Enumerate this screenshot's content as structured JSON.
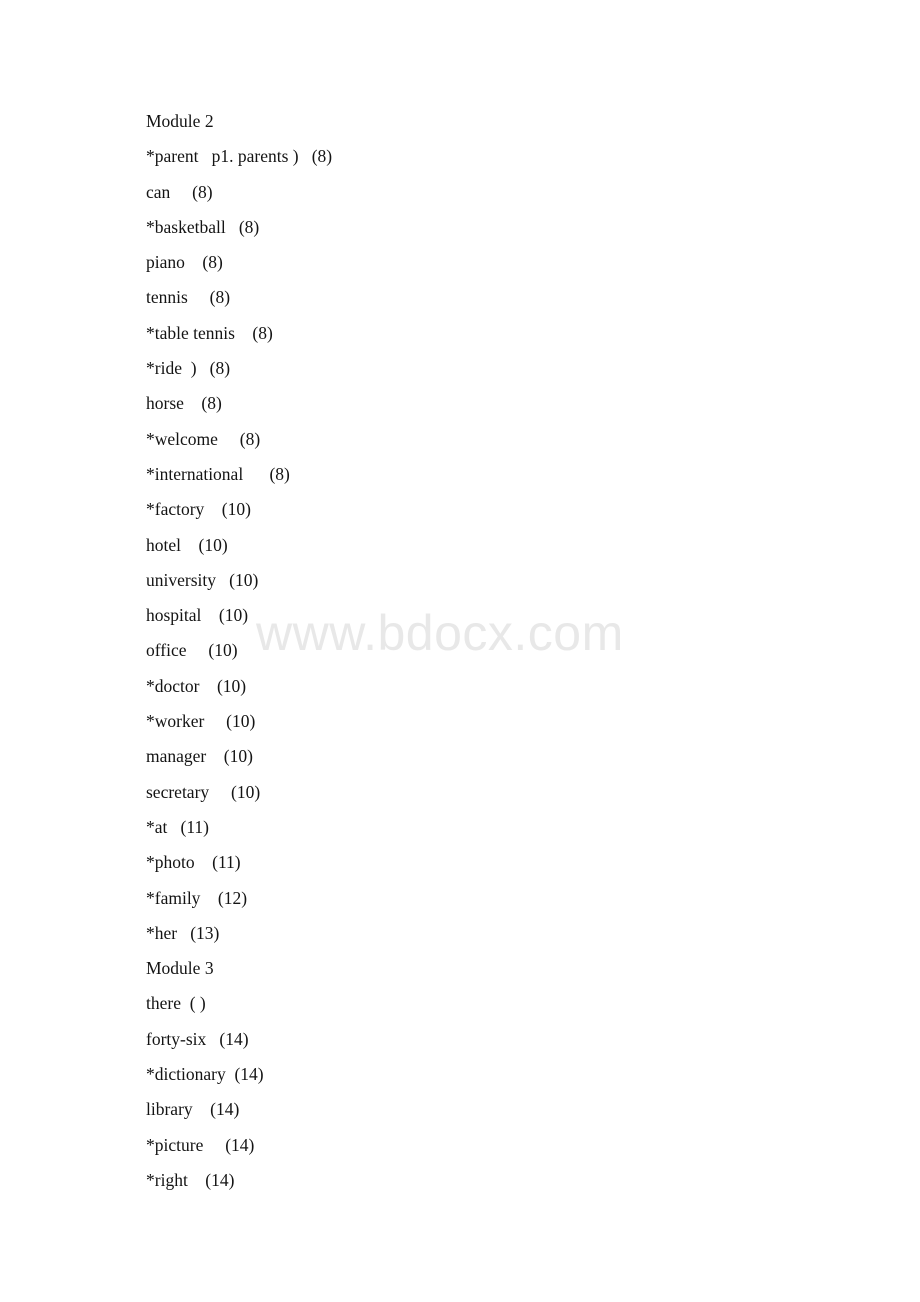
{
  "document": {
    "background_color": "#ffffff",
    "text_color": "#141414",
    "watermark": {
      "text": "www.bdocx.com",
      "color": "#e8e8e8"
    },
    "lines": [
      {
        "text": "Module 2"
      },
      {
        "text": "*parent   p1. parents )   (8)"
      },
      {
        "text": "can     (8)"
      },
      {
        "text": "*basketball   (8)"
      },
      {
        "text": "piano    (8)"
      },
      {
        "text": "tennis     (8)"
      },
      {
        "text": "*table tennis    (8)"
      },
      {
        "text": "*ride  )   (8)"
      },
      {
        "text": "horse    (8)"
      },
      {
        "text": "*welcome     (8)"
      },
      {
        "text": "*international      (8)"
      },
      {
        "text": "*factory    (10)"
      },
      {
        "text": "hotel    (10)"
      },
      {
        "text": "university   (10)"
      },
      {
        "text": "hospital    (10)"
      },
      {
        "text": "office     (10)"
      },
      {
        "text": "*doctor    (10)"
      },
      {
        "text": "*worker     (10)"
      },
      {
        "text": "manager    (10)"
      },
      {
        "text": "secretary     (10)"
      },
      {
        "text": "*at   (11)"
      },
      {
        "text": "*photo    (11)"
      },
      {
        "text": "*family    (12)"
      },
      {
        "text": "*her   (13)"
      },
      {
        "text": "Module 3"
      },
      {
        "text": "there  ( )"
      },
      {
        "text": "forty-six   (14)"
      },
      {
        "text": "*dictionary  (14)"
      },
      {
        "text": "library    (14)"
      },
      {
        "text": "*picture     (14)"
      },
      {
        "text": "*right    (14)"
      }
    ]
  }
}
